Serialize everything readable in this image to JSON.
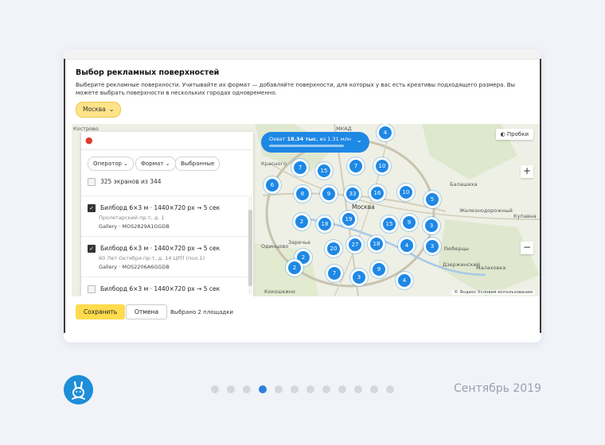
{
  "dialog": {
    "title": "Выбор рекламных поверхностей",
    "description": "Выберите рекламные поверхности. Учитывайте их формат — добавляйте поверхности, для которых у вас есть креативы подходящего размера. Вы можете выбрать поверхности в нескольких городах одновременно.",
    "city": "Москва"
  },
  "panel": {
    "filters": {
      "operator": "Оператор",
      "format": "Формат",
      "selected": "Выбранные"
    },
    "count_label": "325 экранов из 344",
    "items": [
      {
        "title": "Билборд 6×3 м · 1440×720 px → 5 сек",
        "address": "Пролетарский пр-т, д. 1",
        "code": "Gallery · MOS2829A1GGDB",
        "checked": true
      },
      {
        "title": "Билборд 6×3 м · 1440×720 px → 5 сек",
        "address": "60 Лет Октября пр-т, д. 14 ЦРП (пол.1)",
        "code": "Gallery · MOS2206A6GGDB",
        "checked": true
      },
      {
        "title": "Билборд 6×3 м · 1440×720 px → 5 сек",
        "address": "",
        "code": "",
        "checked": false
      }
    ]
  },
  "map": {
    "coverage": {
      "prefix": "Охват",
      "value": "18.34 тыс.",
      "suffix": "из 1.31 млн"
    },
    "traffic": "Пробки",
    "copyright": "© Яндекс  Условия использования",
    "labels": {
      "kostrovo": "Кострово",
      "krasnogorsk": "Красного",
      "moskva": "Москва",
      "balashikha": "Балашиха",
      "zheleznodorozhny": "Железнодорожный",
      "kupavna": "Купавна",
      "lyubertsy": "Люберцы",
      "dzerzhinsky": "Дзержинский",
      "malakhovka": "Малаховка",
      "odintsovo": "Одинцово",
      "zarechye": "Заречье",
      "kokoshkino": "Кокошкино",
      "mkad": "МКАД"
    },
    "clusters": [
      {
        "n": "4"
      },
      {
        "n": "7"
      },
      {
        "n": "15"
      },
      {
        "n": "7"
      },
      {
        "n": "10"
      },
      {
        "n": "6"
      },
      {
        "n": "8"
      },
      {
        "n": "9"
      },
      {
        "n": "33"
      },
      {
        "n": "16"
      },
      {
        "n": "10"
      },
      {
        "n": "5"
      },
      {
        "n": "2"
      },
      {
        "n": "18"
      },
      {
        "n": "19"
      },
      {
        "n": "15"
      },
      {
        "n": "9"
      },
      {
        "n": "3"
      },
      {
        "n": "2"
      },
      {
        "n": "20"
      },
      {
        "n": "27"
      },
      {
        "n": "18"
      },
      {
        "n": "4"
      },
      {
        "n": "3"
      },
      {
        "n": "2"
      },
      {
        "n": "7"
      },
      {
        "n": "3"
      },
      {
        "n": "9"
      },
      {
        "n": "4"
      }
    ]
  },
  "footer": {
    "save": "Сохранить",
    "cancel": "Отмена",
    "selected_text": "Выбрано 2 площадки"
  },
  "carousel": {
    "pages": 12,
    "active_index": 3
  },
  "date": "Сентябрь 2019",
  "colors": {
    "accent": "#1e88e5",
    "save_button": "#ffdb4d",
    "city_button": "#ffe38a",
    "active_dot": "#2e7fdc"
  }
}
